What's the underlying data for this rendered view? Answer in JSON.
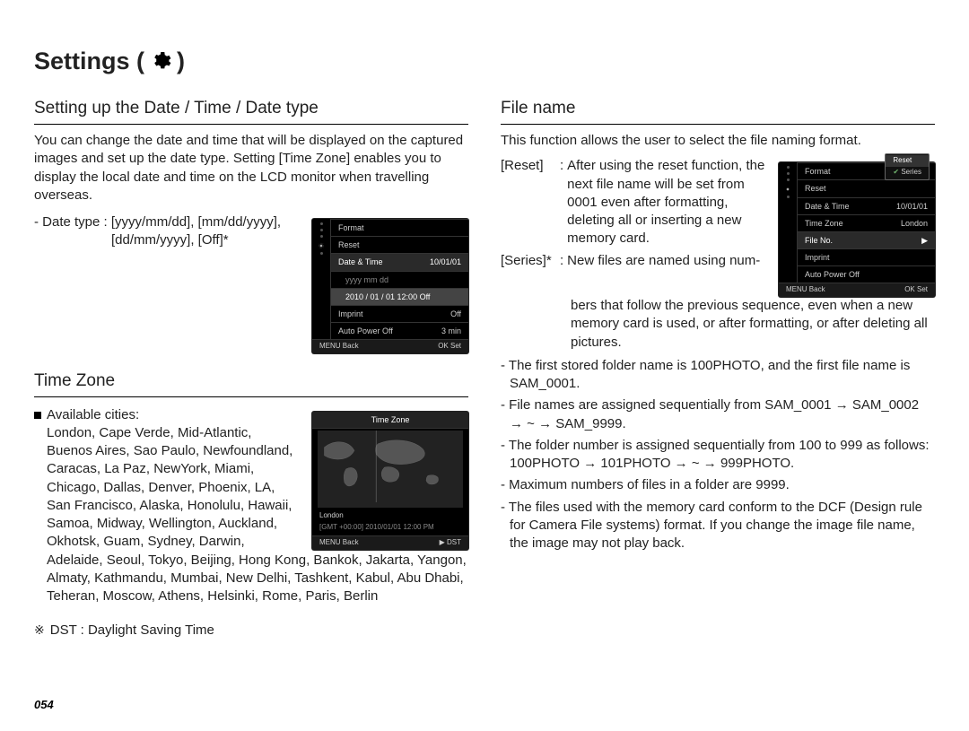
{
  "pageTitle": {
    "prefix": "Settings (",
    "suffix": " )"
  },
  "left": {
    "h1": "Setting up the Date / Time / Date type",
    "intro": "You can change the date and time that will be displayed on the captured images and set up the date type. Setting [Time Zone] enables you to display the local date and time on the LCD monitor when travelling overseas.",
    "datetype_label": "- Date type : [yyyy/mm/dd], [mm/dd/yyyy],",
    "datetype_label2": "[dd/mm/yyyy], [Off]*",
    "menu1": {
      "items": [
        {
          "l": "Format",
          "r": ""
        },
        {
          "l": "Reset",
          "r": ""
        },
        {
          "l": "Date & Time",
          "r": "10/01/01",
          "hl": true
        },
        {
          "l": "yyyy mm dd",
          "r": "",
          "sub": true
        },
        {
          "l": "2010 / 01 / 01   12:00   Off",
          "r": "",
          "sub": true
        },
        {
          "l": "Imprint",
          "r": "Off"
        },
        {
          "l": "Auto Power Off",
          "r": "3 min"
        }
      ],
      "ftr": {
        "l": "MENU Back",
        "r": "OK Set"
      }
    },
    "h2": "Time Zone",
    "avail_label": "Available cities:",
    "cities": "London, Cape Verde, Mid-Atlantic, Buenos Aires, Sao Paulo, Newfoundland, Caracas, La Paz, NewYork, Miami, Chicago, Dallas, Denver, Phoenix, LA, San Francisco, Alaska, Honolulu, Hawaii, Samoa, Midway, Wellington, Auckland, Okhotsk, Guam, Sydney, Darwin, Adelaide, Seoul, Tokyo, Beijing, Hong Kong, Bankok, Jakarta, Yangon, Almaty, Kathmandu, Mumbai, New Delhi, Tashkent, Kabul, Abu Dhabi, Teheran, Moscow, Athens, Helsinki, Rome, Paris, Berlin",
    "dst_note": "DST : Daylight Saving Time",
    "menu2": {
      "title": "Time Zone",
      "city": "London",
      "gmt": "[GMT +00:00]   2010/01/01   12:00 PM",
      "ftr": {
        "l": "MENU Back",
        "r": "▶ DST"
      }
    }
  },
  "right": {
    "h1": "File name",
    "intro": "This function allows the user to select the file naming format.",
    "reset_label": "[Reset]",
    "reset_sep": ": ",
    "reset_body": "After using the reset function, the next file name will be set from 0001 even after formatting, deleting all or inserting a new memory card.",
    "series_label": "[Series]*",
    "series_sep": ": ",
    "series_body": "New files are named using num- bers that follow the previous sequence, even when a new memory card is used, or after formatting, or after deleting all pictures.",
    "bullets": [
      "The first stored folder name is 100PHOTO, and the first file name is SAM_0001.",
      "File names are assigned sequentially from SAM_0001 → SAM_0002 → ~ → SAM_9999.",
      "The folder number is assigned sequentially from 100 to 999 as follows: 100PHOTO → 101PHOTO → ~ → 999PHOTO.",
      "Maximum numbers of files in a folder are 9999.",
      "The files used with the memory card conform to the DCF (Design rule for Camera File systems) format. If you change the image file name, the image may not play back."
    ],
    "menu3": {
      "items": [
        {
          "l": "Format",
          "r": ""
        },
        {
          "l": "Reset",
          "r": ""
        },
        {
          "l": "Date & Time",
          "r": "10/01/01"
        },
        {
          "l": "Time Zone",
          "r": "London"
        },
        {
          "l": "File No.",
          "r": "",
          "hl": true
        },
        {
          "l": "Imprint",
          "r": ""
        },
        {
          "l": "Auto Power Off",
          "r": ""
        }
      ],
      "popup": {
        "opt1": "Reset",
        "opt2": "Series"
      },
      "ftr": {
        "l": "MENU Back",
        "r": "OK Set"
      }
    }
  },
  "pageNumber": "054"
}
